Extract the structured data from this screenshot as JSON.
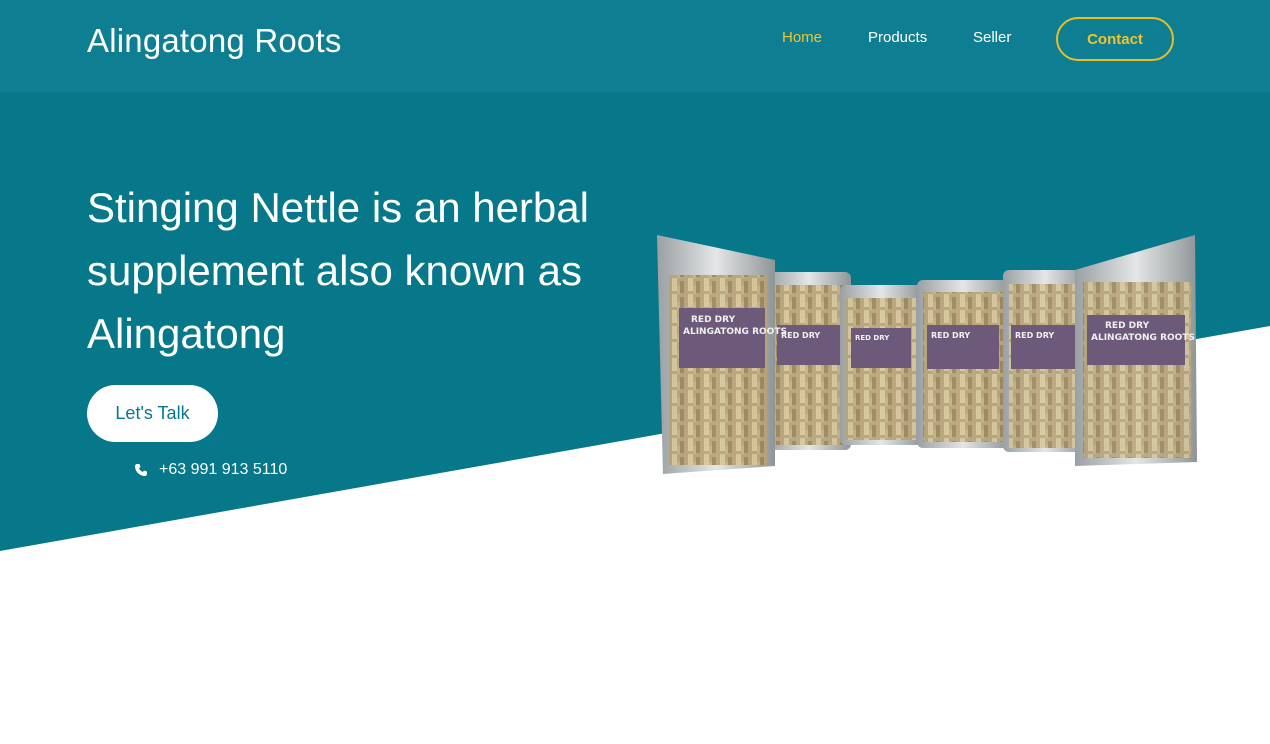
{
  "header": {
    "brand": "Alingatong Roots",
    "nav": [
      {
        "label": "Home",
        "active": true
      },
      {
        "label": "Products",
        "active": false
      },
      {
        "label": "Seller",
        "active": false
      }
    ],
    "contact_label": "Contact"
  },
  "hero": {
    "headline": "Stinging Nettle is an herbal supplement also known as Alingatong",
    "cta_label": "Let's Talk",
    "phone": "+63 991 913 5110",
    "phone_icon": "phone-icon",
    "bag_labels": {
      "line1": "RED DRY",
      "line2": "ALINGATONG ROOTS"
    }
  },
  "colors": {
    "hero_bg": "#06788a",
    "navbar_bg": "#0e7f93",
    "accent": "#f2c230",
    "text": "#ffffff"
  }
}
